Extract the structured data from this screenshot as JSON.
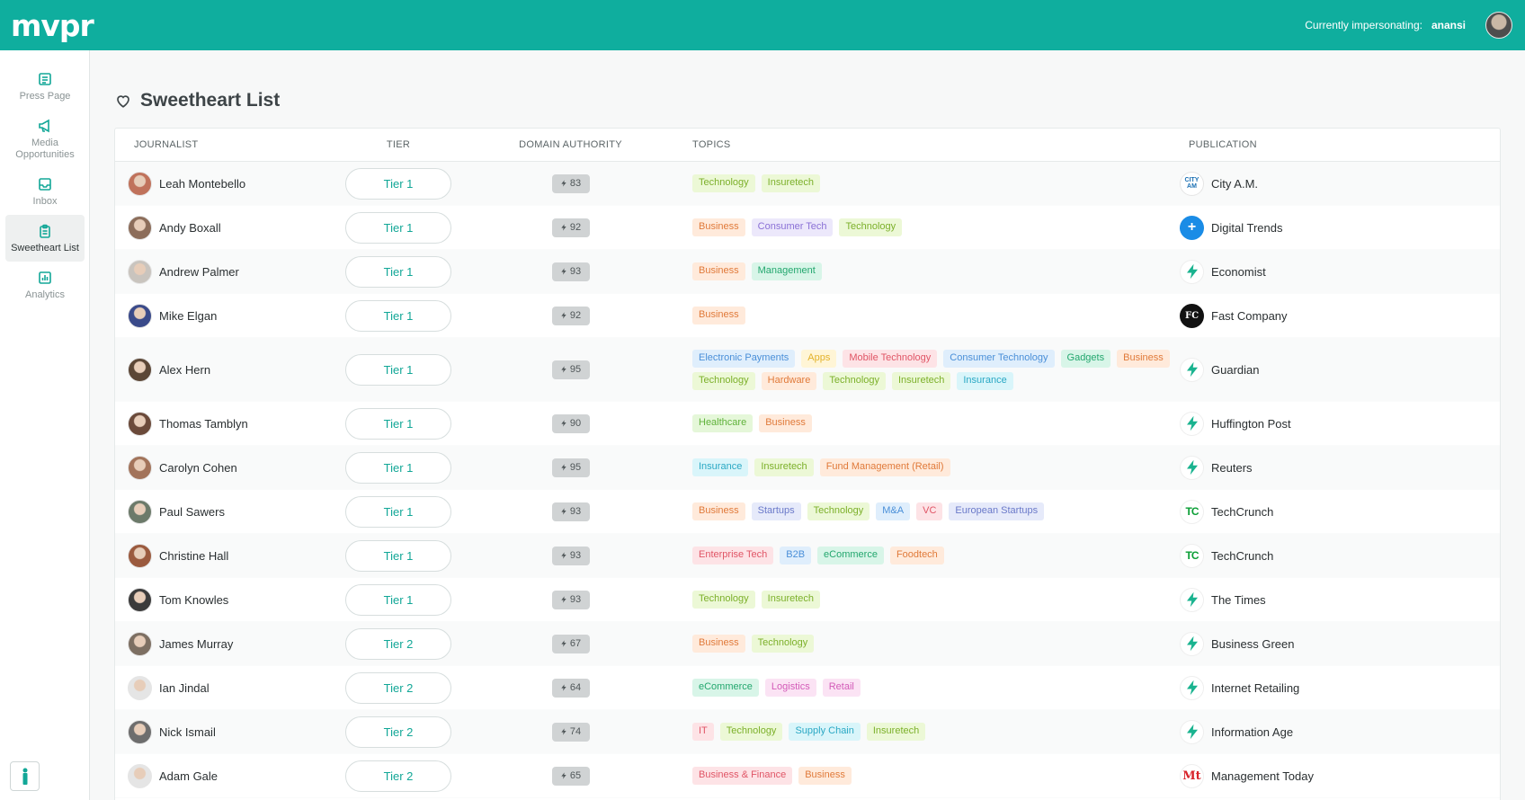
{
  "app": {
    "logo": "mvpr"
  },
  "header": {
    "impersonating_label": "Currently impersonating:",
    "impersonating_user": "anansi"
  },
  "sidebar": {
    "items": [
      {
        "label": "Press Page",
        "icon": "newspaper-icon"
      },
      {
        "label": "Media Opportunities",
        "icon": "megaphone-icon"
      },
      {
        "label": "Inbox",
        "icon": "inbox-icon"
      },
      {
        "label": "Sweetheart List",
        "icon": "clipboard-icon",
        "active": true
      },
      {
        "label": "Analytics",
        "icon": "chart-icon"
      }
    ]
  },
  "page": {
    "title": "Sweetheart List"
  },
  "table": {
    "headers": {
      "journalist": "JOURNALIST",
      "tier": "TIER",
      "domain_authority": "DOMAIN AUTHORITY",
      "topics": "TOPICS",
      "publication": "PUBLICATION"
    },
    "rows": [
      {
        "journalist": "Leah Montebello",
        "tier": "Tier 1",
        "da": "83",
        "topics": [
          "Technology",
          "Insuretech"
        ],
        "publication": "City A.M.",
        "pub_logo": "CITY AM"
      },
      {
        "journalist": "Andy Boxall",
        "tier": "Tier 1",
        "da": "92",
        "topics": [
          "Business",
          "Consumer Tech",
          "Technology"
        ],
        "publication": "Digital Trends",
        "pub_logo": "+"
      },
      {
        "journalist": "Andrew Palmer",
        "tier": "Tier 1",
        "da": "93",
        "topics": [
          "Business",
          "Management"
        ],
        "publication": "Economist",
        "pub_logo": ""
      },
      {
        "journalist": "Mike Elgan",
        "tier": "Tier 1",
        "da": "92",
        "topics": [
          "Business"
        ],
        "publication": "Fast Company",
        "pub_logo": "FC"
      },
      {
        "journalist": "Alex Hern",
        "tier": "Tier 1",
        "da": "95",
        "topics": [
          "Electronic Payments",
          "Apps",
          "Mobile Technology",
          "Consumer Technology",
          "Gadgets",
          "Business",
          "Technology",
          "Hardware",
          "Technology",
          "Insuretech",
          "Insurance"
        ],
        "publication": "Guardian",
        "pub_logo": ""
      },
      {
        "journalist": "Thomas Tamblyn",
        "tier": "Tier 1",
        "da": "90",
        "topics": [
          "Healthcare",
          "Business"
        ],
        "publication": "Huffington Post",
        "pub_logo": ""
      },
      {
        "journalist": "Carolyn Cohen",
        "tier": "Tier 1",
        "da": "95",
        "topics": [
          "Insurance",
          "Insuretech",
          "Fund Management (Retail)"
        ],
        "publication": "Reuters",
        "pub_logo": ""
      },
      {
        "journalist": "Paul Sawers",
        "tier": "Tier 1",
        "da": "93",
        "topics": [
          "Business",
          "Startups",
          "Technology",
          "M&A",
          "VC",
          "European Startups"
        ],
        "publication": "TechCrunch",
        "pub_logo": "TC"
      },
      {
        "journalist": "Christine Hall",
        "tier": "Tier 1",
        "da": "93",
        "topics": [
          "Enterprise Tech",
          "B2B",
          "eCommerce",
          "Foodtech"
        ],
        "publication": "TechCrunch",
        "pub_logo": "TC"
      },
      {
        "journalist": "Tom Knowles",
        "tier": "Tier 1",
        "da": "93",
        "topics": [
          "Technology",
          "Insuretech"
        ],
        "publication": "The Times",
        "pub_logo": ""
      },
      {
        "journalist": "James Murray",
        "tier": "Tier 2",
        "da": "67",
        "topics": [
          "Business",
          "Technology"
        ],
        "publication": "Business Green",
        "pub_logo": ""
      },
      {
        "journalist": "Ian Jindal",
        "tier": "Tier 2",
        "da": "64",
        "topics": [
          "eCommerce",
          "Logistics",
          "Retail"
        ],
        "publication": "Internet Retailing",
        "pub_logo": ""
      },
      {
        "journalist": "Nick Ismail",
        "tier": "Tier 2",
        "da": "74",
        "topics": [
          "IT",
          "Technology",
          "Supply Chain",
          "Insuretech"
        ],
        "publication": "Information Age",
        "pub_logo": ""
      },
      {
        "journalist": "Adam Gale",
        "tier": "Tier 2",
        "da": "65",
        "topics": [
          "Business & Finance",
          "Business"
        ],
        "publication": "Management Today",
        "pub_logo": "Mt"
      }
    ]
  },
  "colors": {
    "brand": "#0fae9e",
    "accent_text": "#12a797"
  }
}
